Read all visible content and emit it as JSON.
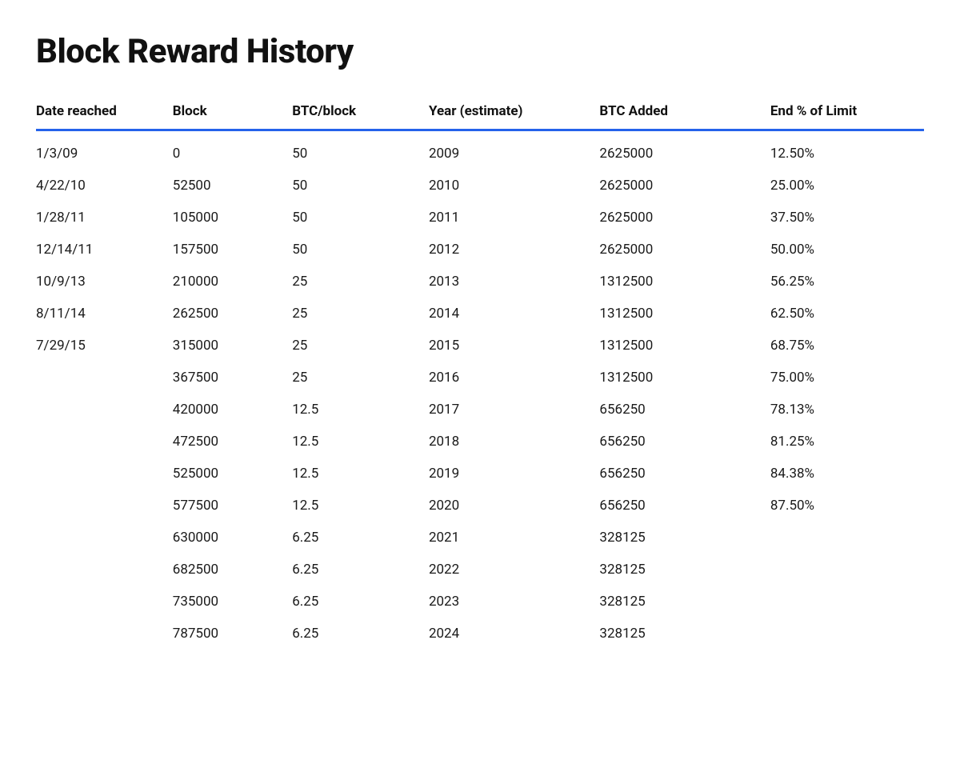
{
  "title": "Block Reward History",
  "table": {
    "headers": [
      {
        "key": "date",
        "label": "Date reached"
      },
      {
        "key": "block",
        "label": "Block"
      },
      {
        "key": "btcblock",
        "label": "BTC/block"
      },
      {
        "key": "year",
        "label": "Year (estimate)"
      },
      {
        "key": "btcadded",
        "label": "BTC Added"
      },
      {
        "key": "endlimit",
        "label": "End % of Limit"
      }
    ],
    "rows": [
      {
        "date": "1/3/09",
        "block": "0",
        "btcblock": "50",
        "year": "2009",
        "btcadded": "2625000",
        "endlimit": "12.50%"
      },
      {
        "date": "4/22/10",
        "block": "52500",
        "btcblock": "50",
        "year": "2010",
        "btcadded": "2625000",
        "endlimit": "25.00%"
      },
      {
        "date": "1/28/11",
        "block": "105000",
        "btcblock": "50",
        "year": "2011",
        "btcadded": "2625000",
        "endlimit": "37.50%"
      },
      {
        "date": "12/14/11",
        "block": "157500",
        "btcblock": "50",
        "year": "2012",
        "btcadded": "2625000",
        "endlimit": "50.00%"
      },
      {
        "date": "10/9/13",
        "block": "210000",
        "btcblock": "25",
        "year": "2013",
        "btcadded": "1312500",
        "endlimit": "56.25%"
      },
      {
        "date": "8/11/14",
        "block": "262500",
        "btcblock": "25",
        "year": "2014",
        "btcadded": "1312500",
        "endlimit": "62.50%"
      },
      {
        "date": "7/29/15",
        "block": "315000",
        "btcblock": "25",
        "year": "2015",
        "btcadded": "1312500",
        "endlimit": "68.75%"
      },
      {
        "date": "",
        "block": "367500",
        "btcblock": "25",
        "year": "2016",
        "btcadded": "1312500",
        "endlimit": "75.00%"
      },
      {
        "date": "",
        "block": "420000",
        "btcblock": "12.5",
        "year": "2017",
        "btcadded": "656250",
        "endlimit": "78.13%"
      },
      {
        "date": "",
        "block": "472500",
        "btcblock": "12.5",
        "year": "2018",
        "btcadded": "656250",
        "endlimit": "81.25%"
      },
      {
        "date": "",
        "block": "525000",
        "btcblock": "12.5",
        "year": "2019",
        "btcadded": "656250",
        "endlimit": "84.38%"
      },
      {
        "date": "",
        "block": "577500",
        "btcblock": "12.5",
        "year": "2020",
        "btcadded": "656250",
        "endlimit": "87.50%"
      },
      {
        "date": "",
        "block": "630000",
        "btcblock": "6.25",
        "year": "2021",
        "btcadded": "328125",
        "endlimit": ""
      },
      {
        "date": "",
        "block": "682500",
        "btcblock": "6.25",
        "year": "2022",
        "btcadded": "328125",
        "endlimit": ""
      },
      {
        "date": "",
        "block": "735000",
        "btcblock": "6.25",
        "year": "2023",
        "btcadded": "328125",
        "endlimit": ""
      },
      {
        "date": "",
        "block": "787500",
        "btcblock": "6.25",
        "year": "2024",
        "btcadded": "328125",
        "endlimit": ""
      }
    ]
  }
}
